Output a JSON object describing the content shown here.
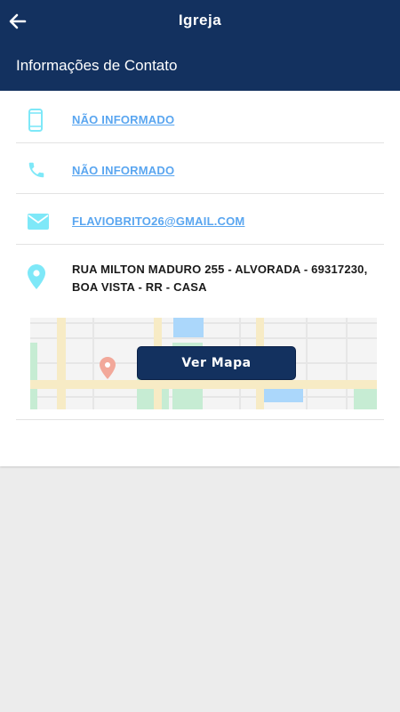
{
  "header": {
    "title": "Igreja",
    "subtitle": "Informações de Contato",
    "background_color": "#13315f"
  },
  "contact": {
    "mobile": {
      "icon": "smartphone-icon",
      "value": "NÃO INFORMADO"
    },
    "phone": {
      "icon": "phone-icon",
      "value": "NÃO INFORMADO"
    },
    "email": {
      "icon": "mail-icon",
      "value": "FLAVIOBRITO26@GMAIL.COM"
    },
    "address": {
      "icon": "location-pin-icon",
      "line1": "RUA MILTON MADURO 255 - ALVORADA - 69317230,",
      "line2": "BOA VISTA - RR - CASA"
    },
    "map_button_label": "Ver Mapa",
    "icon_color": "#7ee8f8",
    "link_color": "#5aa6f0"
  }
}
